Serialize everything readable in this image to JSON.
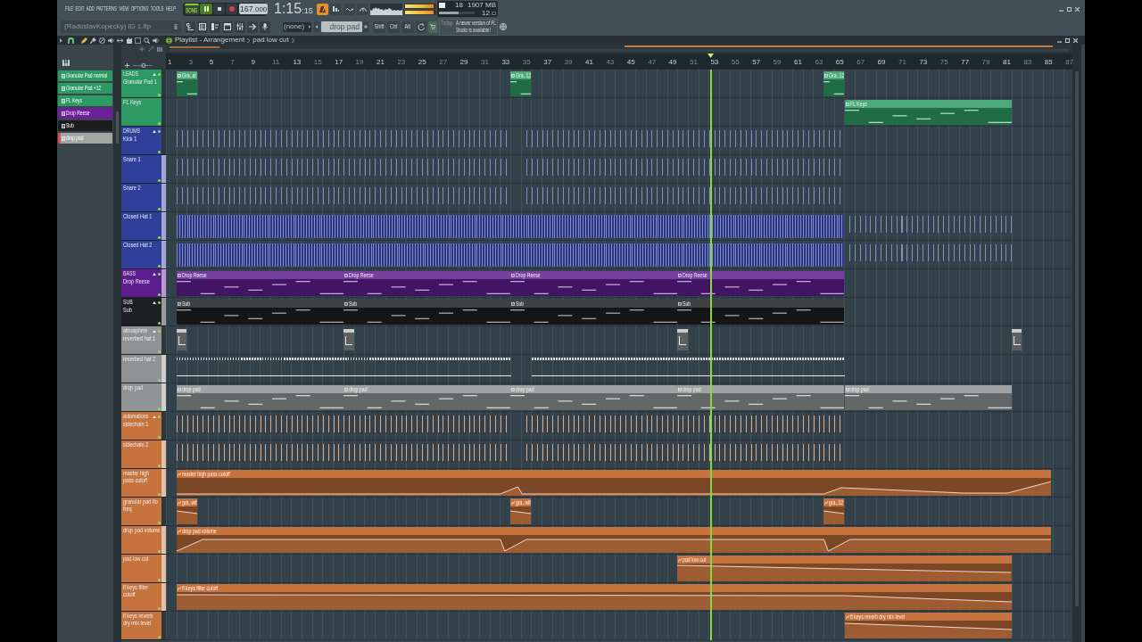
{
  "menu": [
    "FILE",
    "EDIT",
    "ADD",
    "PATTERNS",
    "VIEW",
    "OPTIONS",
    "TOOLS",
    "HELP"
  ],
  "project_hint": "(RadoslavKopecky) ID 1.flp",
  "transport": {
    "mode": "SONG",
    "playing": true,
    "tempo": "167",
    "tempo_decimals": ".000",
    "time": "1:15",
    "time_small": ":15"
  },
  "output_meters": [
    {
      "level": 0.95
    },
    {
      "level": 0.93
    }
  ],
  "monitor": {
    "cpu": {
      "level": 0.55
    },
    "voices": "18",
    "memory": "1907 MB",
    "polyphony": "12"
  },
  "toolbar": {
    "midi_input": "(none)",
    "pattern": "drop pad",
    "keys": [
      "Shift",
      "Ctrl",
      "Alt"
    ]
  },
  "news": {
    "date": "Today",
    "text": "A newer version of FL Studio is available!"
  },
  "playlist": {
    "title": "Playlist - Arrangement",
    "path": "pad low cut"
  },
  "patterns": [
    {
      "name": "Granular Pad normal",
      "color": "#2c9b63",
      "selected": false
    },
    {
      "name": "Granular Pad +12",
      "color": "#2c9b63",
      "selected": false
    },
    {
      "name": "FL Keys",
      "color": "#2c9b63",
      "selected": false
    },
    {
      "name": "Drop Reese",
      "color": "#6c1f9c",
      "selected": false
    },
    {
      "name": "Sub",
      "color": "#1b1d1e",
      "selected": false
    },
    {
      "name": "drop pad",
      "color": "#a3a6a3",
      "selected": true
    }
  ],
  "ruler": [
    "1",
    "3",
    "5",
    "7",
    "9",
    "11",
    "13",
    "15",
    "17",
    "19",
    "21",
    "23",
    "25",
    "27",
    "29",
    "31",
    "33",
    "35",
    "37",
    "39",
    "41",
    "43",
    "45",
    "47",
    "49",
    "51",
    "53",
    "55",
    "57",
    "59",
    "61",
    "63",
    "65",
    "67",
    "69",
    "71",
    "73",
    "75",
    "77",
    "79",
    "81",
    "83",
    "85",
    "87"
  ],
  "playhead": {
    "level": 0.601
  },
  "track_groups": [
    {
      "name": "LEADS",
      "color": "#2e9a63",
      "tracks": [
        {
          "name": "Granular Pad 1",
          "active": false,
          "clips": [
            {
              "kind": "notes",
              "label": "Gra..al"
            },
            {
              "kind": "notes",
              "label": "Gra..12"
            },
            {
              "kind": "notes",
              "label": "Gra..12"
            }
          ]
        },
        {
          "name": "FL Keys",
          "active": false,
          "clips": [
            {
              "kind": "notes",
              "label": "FL Keys"
            }
          ]
        }
      ]
    },
    {
      "name": "DRUMS",
      "color": "#2f3f9a",
      "tracks": [
        {
          "name": "Kick 1",
          "active": false,
          "clips": [
            {
              "kind": "hits"
            },
            {
              "kind": "hits"
            }
          ]
        },
        {
          "name": "Snare 1",
          "active": true,
          "clips": [
            {
              "kind": "hits"
            },
            {
              "kind": "hits"
            }
          ]
        },
        {
          "name": "Snare 2",
          "active": true,
          "clips": [
            {
              "kind": "hits"
            },
            {
              "kind": "hits"
            }
          ]
        },
        {
          "name": "Closed Hat 1",
          "active": true,
          "clips": [
            {
              "kind": "hats"
            },
            {
              "kind": "hits"
            }
          ]
        },
        {
          "name": "Closed Hat 2",
          "active": true,
          "clips": [
            {
              "kind": "hats"
            },
            {
              "kind": "hits"
            }
          ]
        }
      ]
    },
    {
      "name": "BASS",
      "color": "#5e1d8f",
      "tracks": [
        {
          "name": "Drop Reese",
          "active": true,
          "clips": [
            {
              "kind": "notes",
              "label": "Drop Reese"
            },
            {
              "kind": "notes",
              "label": "Drop Reese"
            },
            {
              "kind": "notes",
              "label": "Drop Reese"
            },
            {
              "kind": "notes",
              "label": "Drop Reese"
            }
          ]
        }
      ]
    },
    {
      "name": "SUB",
      "color": "#1d2022",
      "tracks": [
        {
          "name": "Sub",
          "active": true,
          "clips": [
            {
              "kind": "notes",
              "label": "Sub"
            },
            {
              "kind": "notes",
              "label": "Sub"
            },
            {
              "kind": "notes",
              "label": "Sub"
            },
            {
              "kind": "notes",
              "label": "Sub"
            }
          ]
        }
      ]
    },
    {
      "name": "atmosphere",
      "color": "#8f9393",
      "tracks": [
        {
          "name": "reverbed hat 1",
          "active": false,
          "clips": [
            {
              "kind": "marker"
            },
            {
              "kind": "marker"
            },
            {
              "kind": "marker"
            },
            {
              "kind": "marker"
            }
          ]
        },
        {
          "name": "reverbed hat 2",
          "active": true,
          "clips": [
            {
              "kind": "line"
            },
            {
              "kind": "line"
            }
          ]
        },
        {
          "name": "drop pad",
          "active": true,
          "clips": [
            {
              "kind": "notes",
              "label": "drop pad"
            },
            {
              "kind": "notes",
              "label": "drop pad"
            },
            {
              "kind": "notes",
              "label": "drop pad"
            },
            {
              "kind": "notes",
              "label": "drop pad"
            },
            {
              "kind": "notes",
              "label": "drop pad"
            }
          ]
        }
      ]
    },
    {
      "name": "automations",
      "color": "#c6733e",
      "tracks": [
        {
          "name": "sidechain 1",
          "active": false,
          "clips": [
            {
              "kind": "hits"
            },
            {
              "kind": "hits"
            }
          ]
        },
        {
          "name": "sidechain 2",
          "active": true,
          "clips": [
            {
              "kind": "hits"
            },
            {
              "kind": "hits"
            }
          ]
        },
        {
          "name": "master high pass cutoff",
          "active": true,
          "clips": [
            {
              "kind": "automation",
              "label": "master high pass cutoff"
            }
          ]
        },
        {
          "name": "granular pad lfo freq",
          "active": false,
          "clips": [
            {
              "kind": "automation",
              "label": "gra..wit"
            },
            {
              "kind": "automation",
              "label": "gra..wit"
            },
            {
              "kind": "automation",
              "label": "gra..12"
            }
          ]
        },
        {
          "name": "drop pad volume",
          "active": true,
          "clips": [
            {
              "kind": "automation",
              "label": "drop pad volume"
            }
          ]
        },
        {
          "name": "pad low cut",
          "active": true,
          "clips": [
            {
              "kind": "automation",
              "label": "pad low cut"
            }
          ]
        },
        {
          "name": "fl keys filter cutoff",
          "active": true,
          "clips": [
            {
              "kind": "automation",
              "label": "fl keys filter cutoff"
            }
          ]
        },
        {
          "name": "fl keys reverb dry mix level",
          "active": false,
          "clips": [
            {
              "kind": "automation",
              "label": "fl keys reverb dry mix level"
            }
          ]
        }
      ]
    }
  ]
}
